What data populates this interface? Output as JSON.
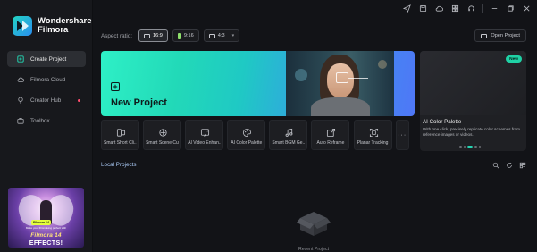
{
  "app": {
    "name_line1": "Wondershare",
    "name_line2": "Filmora"
  },
  "sidebar": {
    "items": [
      {
        "label": "Create Project",
        "icon": "create-project-icon",
        "active": true
      },
      {
        "label": "Filmora Cloud",
        "icon": "cloud-icon",
        "active": false
      },
      {
        "label": "Creator Hub",
        "icon": "lightbulb-icon",
        "active": false,
        "has_notification": true
      },
      {
        "label": "Toolbox",
        "icon": "toolbox-icon",
        "active": false
      }
    ],
    "promo": {
      "badge": "Filmora 14",
      "small_text": "Make your filmmaking perfect with",
      "title": "Filmora 14",
      "subtitle": "EFFECTS!"
    }
  },
  "titlebar": {
    "icons": [
      "send-icon",
      "save-icon",
      "cloud-upload-icon",
      "grid-icon",
      "headset-icon",
      "minimize-icon",
      "restore-icon",
      "close-icon"
    ]
  },
  "aspect": {
    "label": "Aspect ratio:",
    "options": [
      {
        "label": "16:9",
        "selected": true
      },
      {
        "label": "9:16",
        "selected": false
      },
      {
        "label": "4:3",
        "selected": false,
        "dropdown": true
      }
    ]
  },
  "open_project": {
    "label": "Open Project"
  },
  "new_project": {
    "label": "New Project"
  },
  "feature_card": {
    "badge": "New",
    "title": "AI Color Palette",
    "description": "With one click, precisely replicate color schemes from reference images or videos.",
    "dot_count": 5,
    "active_dot": 2
  },
  "tools": [
    {
      "label": "Smart Short Cli...",
      "icon": "smart-short-clips-icon"
    },
    {
      "label": "Smart Scene Cut",
      "icon": "scene-cut-icon"
    },
    {
      "label": "AI Video Enhan...",
      "icon": "video-enhancer-icon"
    },
    {
      "label": "AI Color Palette",
      "icon": "color-palette-icon"
    },
    {
      "label": "Smart BGM Ge...",
      "icon": "music-icon"
    },
    {
      "label": "Auto Reframe",
      "icon": "reframe-icon"
    },
    {
      "label": "Planar Tracking",
      "icon": "tracking-icon"
    }
  ],
  "tools_more": "···",
  "local_projects": {
    "title": "Local Projects",
    "empty_label": "Recent Project"
  },
  "colors": {
    "accent": "#26d6b4",
    "banner_start": "#2ef0c6",
    "banner_end": "#4f77f6",
    "background": "#121317"
  }
}
